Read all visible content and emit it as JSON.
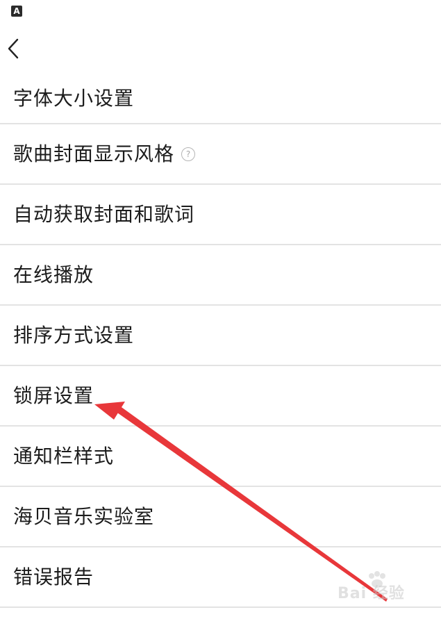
{
  "status_bar": {
    "icon_name": "text-a-icon",
    "icon_glyph": "A"
  },
  "nav": {
    "back_icon": "chevron-left-icon"
  },
  "settings": {
    "items": [
      {
        "label": "字体大小设置"
      },
      {
        "label": "歌曲封面显示风格",
        "help": "?"
      },
      {
        "label": "自动获取封面和歌词"
      },
      {
        "label": "在线播放"
      },
      {
        "label": "排序方式设置"
      },
      {
        "label": "锁屏设置"
      },
      {
        "label": "通知栏样式"
      },
      {
        "label": "海贝音乐实验室"
      },
      {
        "label": "错误报告"
      }
    ]
  },
  "annotation": {
    "arrow_color": "#e8373a",
    "points_to": "锁屏设置"
  },
  "watermark": {
    "text": "Bai 经验"
  },
  "colors": {
    "background": "#ffffff",
    "divider": "#e3e3e3",
    "text": "#1c1c1c",
    "help_icon": "#b5b5b5"
  }
}
